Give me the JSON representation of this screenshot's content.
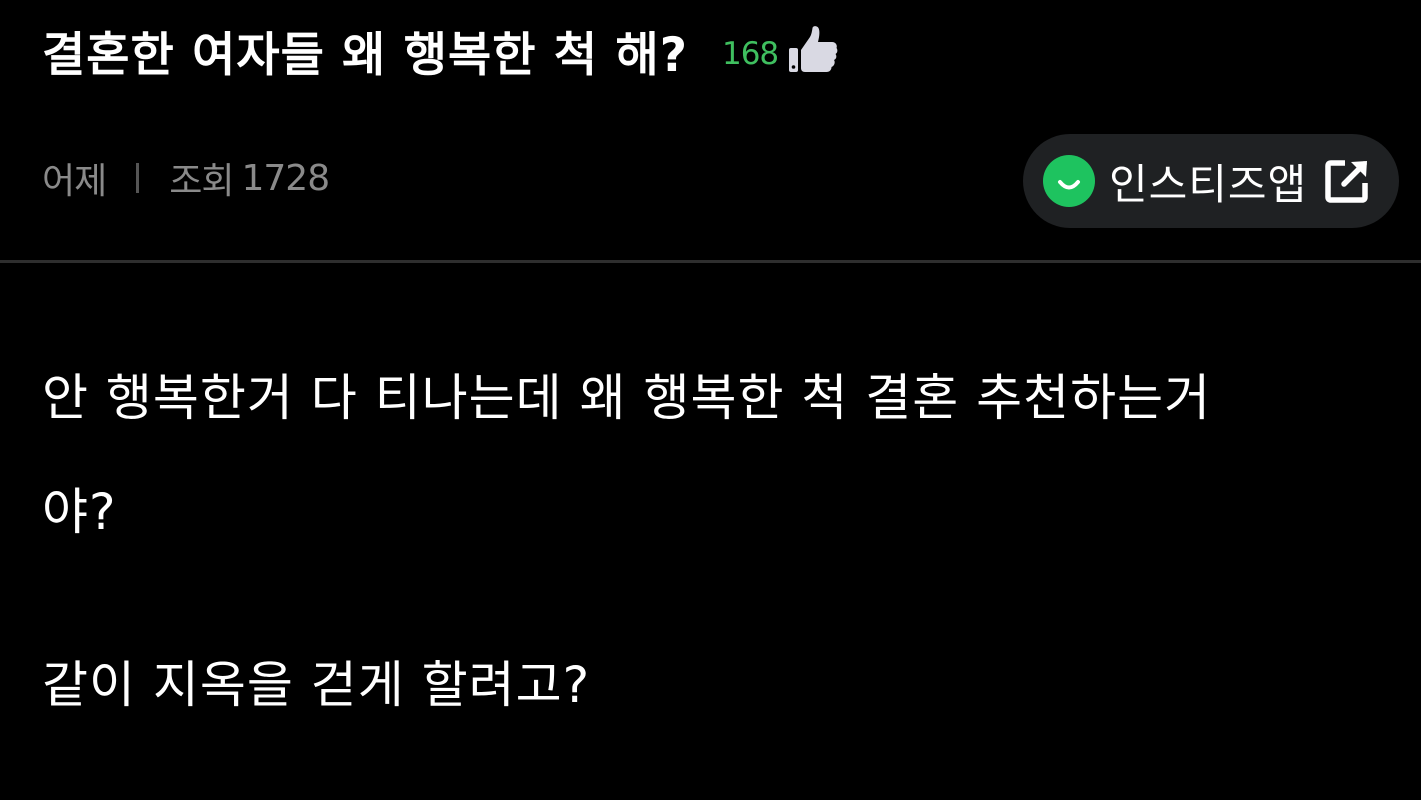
{
  "post": {
    "title": "결혼한 여자들 왜 행복한 척 해?",
    "like_count": "168",
    "time": "어제",
    "view_label": "조회",
    "view_count": "1728",
    "body_lines": [
      "안 행복한거 다 티나는데 왜 행복한 척 결혼 추천하는거",
      "야?",
      "같이 지옥을 걷게 할려고?"
    ]
  },
  "app_button": {
    "label": "인스티즈앱"
  },
  "icons": {
    "like": "thumbs-up-icon",
    "app_logo": "smile-logo-icon",
    "external": "external-link-icon"
  },
  "colors": {
    "background": "#000000",
    "like_count": "#3fbf5f",
    "meta_text": "#8a8a8a",
    "button_bg": "#1f2123",
    "logo_green": "#1ec35f",
    "divider": "#2e2e2e"
  }
}
